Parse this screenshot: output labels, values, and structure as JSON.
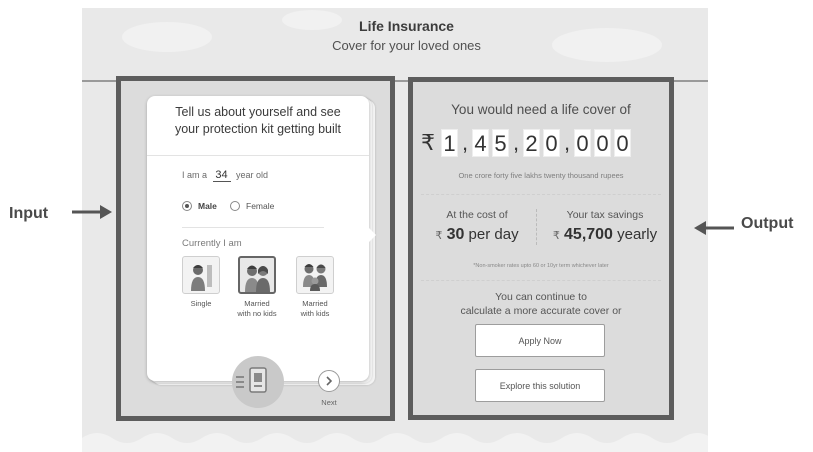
{
  "header": {
    "title": "Life Insurance",
    "subtitle": "Cover for your loved ones"
  },
  "input_panel": {
    "heading_line1": "Tell us about yourself and see",
    "heading_line2": "your protection kit getting built",
    "age_prefix": "I am a",
    "age_value": "34",
    "age_suffix": "year old",
    "gender_options": [
      {
        "label": "Male",
        "selected": true
      },
      {
        "label": "Female",
        "selected": false
      }
    ],
    "status_heading": "Currently I am",
    "status_options": [
      {
        "label_line1": "Single",
        "label_line2": "",
        "selected": false
      },
      {
        "label_line1": "Married",
        "label_line2": "with no kids",
        "selected": true
      },
      {
        "label_line1": "Married",
        "label_line2": "with kids",
        "selected": false
      }
    ],
    "next_label": "Next"
  },
  "output_panel": {
    "title": "You would need a life cover of",
    "currency_symbol": "₹",
    "amount_chars": [
      "1",
      ",",
      "4",
      "5",
      ",",
      "2",
      "0",
      ",",
      "0",
      "0",
      "0"
    ],
    "amount_words": "One crore forty five lakhs twenty thousand rupees",
    "cost_label": "At the cost of",
    "cost_symbol": "₹",
    "cost_value": "30",
    "cost_unit": "per day",
    "tax_label": "Your tax savings",
    "tax_symbol": "₹",
    "tax_value": "45,700",
    "tax_unit": "yearly",
    "note": "*Non-smoker rates upto 60 or 10yr term whichever later",
    "continue_line1": "You can continue to",
    "continue_line2": "calculate a more accurate cover or",
    "apply_label": "Apply Now",
    "explore_label": "Explore this solution"
  },
  "annotations": {
    "input_label": "Input",
    "output_label": "Output"
  },
  "colors": {
    "frame": "#5d5d5d",
    "background": "#e9e9e9",
    "card": "#ffffff"
  }
}
